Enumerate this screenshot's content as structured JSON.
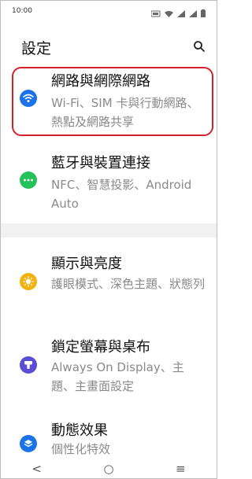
{
  "status": {
    "time": "10:00"
  },
  "header": {
    "title": "設定"
  },
  "items": [
    {
      "title": "網路與網際網路",
      "subtitle": "Wi-Fi、SIM 卡與行動網路、熱點及網路共享",
      "icon": "wifi-icon",
      "color": "#1a73e8"
    },
    {
      "title": "藍牙與裝置連接",
      "subtitle": "NFC、智慧投影、Android Auto",
      "icon": "bluetooth-devices-icon",
      "color": "#24c05a"
    },
    {
      "title": "顯示與亮度",
      "subtitle": "護眼模式、深色主題、狀態列",
      "icon": "brightness-icon",
      "color": "#f2b20d"
    },
    {
      "title": "鎖定螢幕與桌布",
      "subtitle": "Always On Display、主題、主畫面設定",
      "icon": "theme-icon",
      "color": "#5b4dd6"
    },
    {
      "title": "動態效果",
      "subtitle": "個性化特效",
      "icon": "effects-icon",
      "color": "#1a73e8"
    }
  ],
  "navbar": {
    "back": "<",
    "home": "○",
    "recents": "≡"
  }
}
